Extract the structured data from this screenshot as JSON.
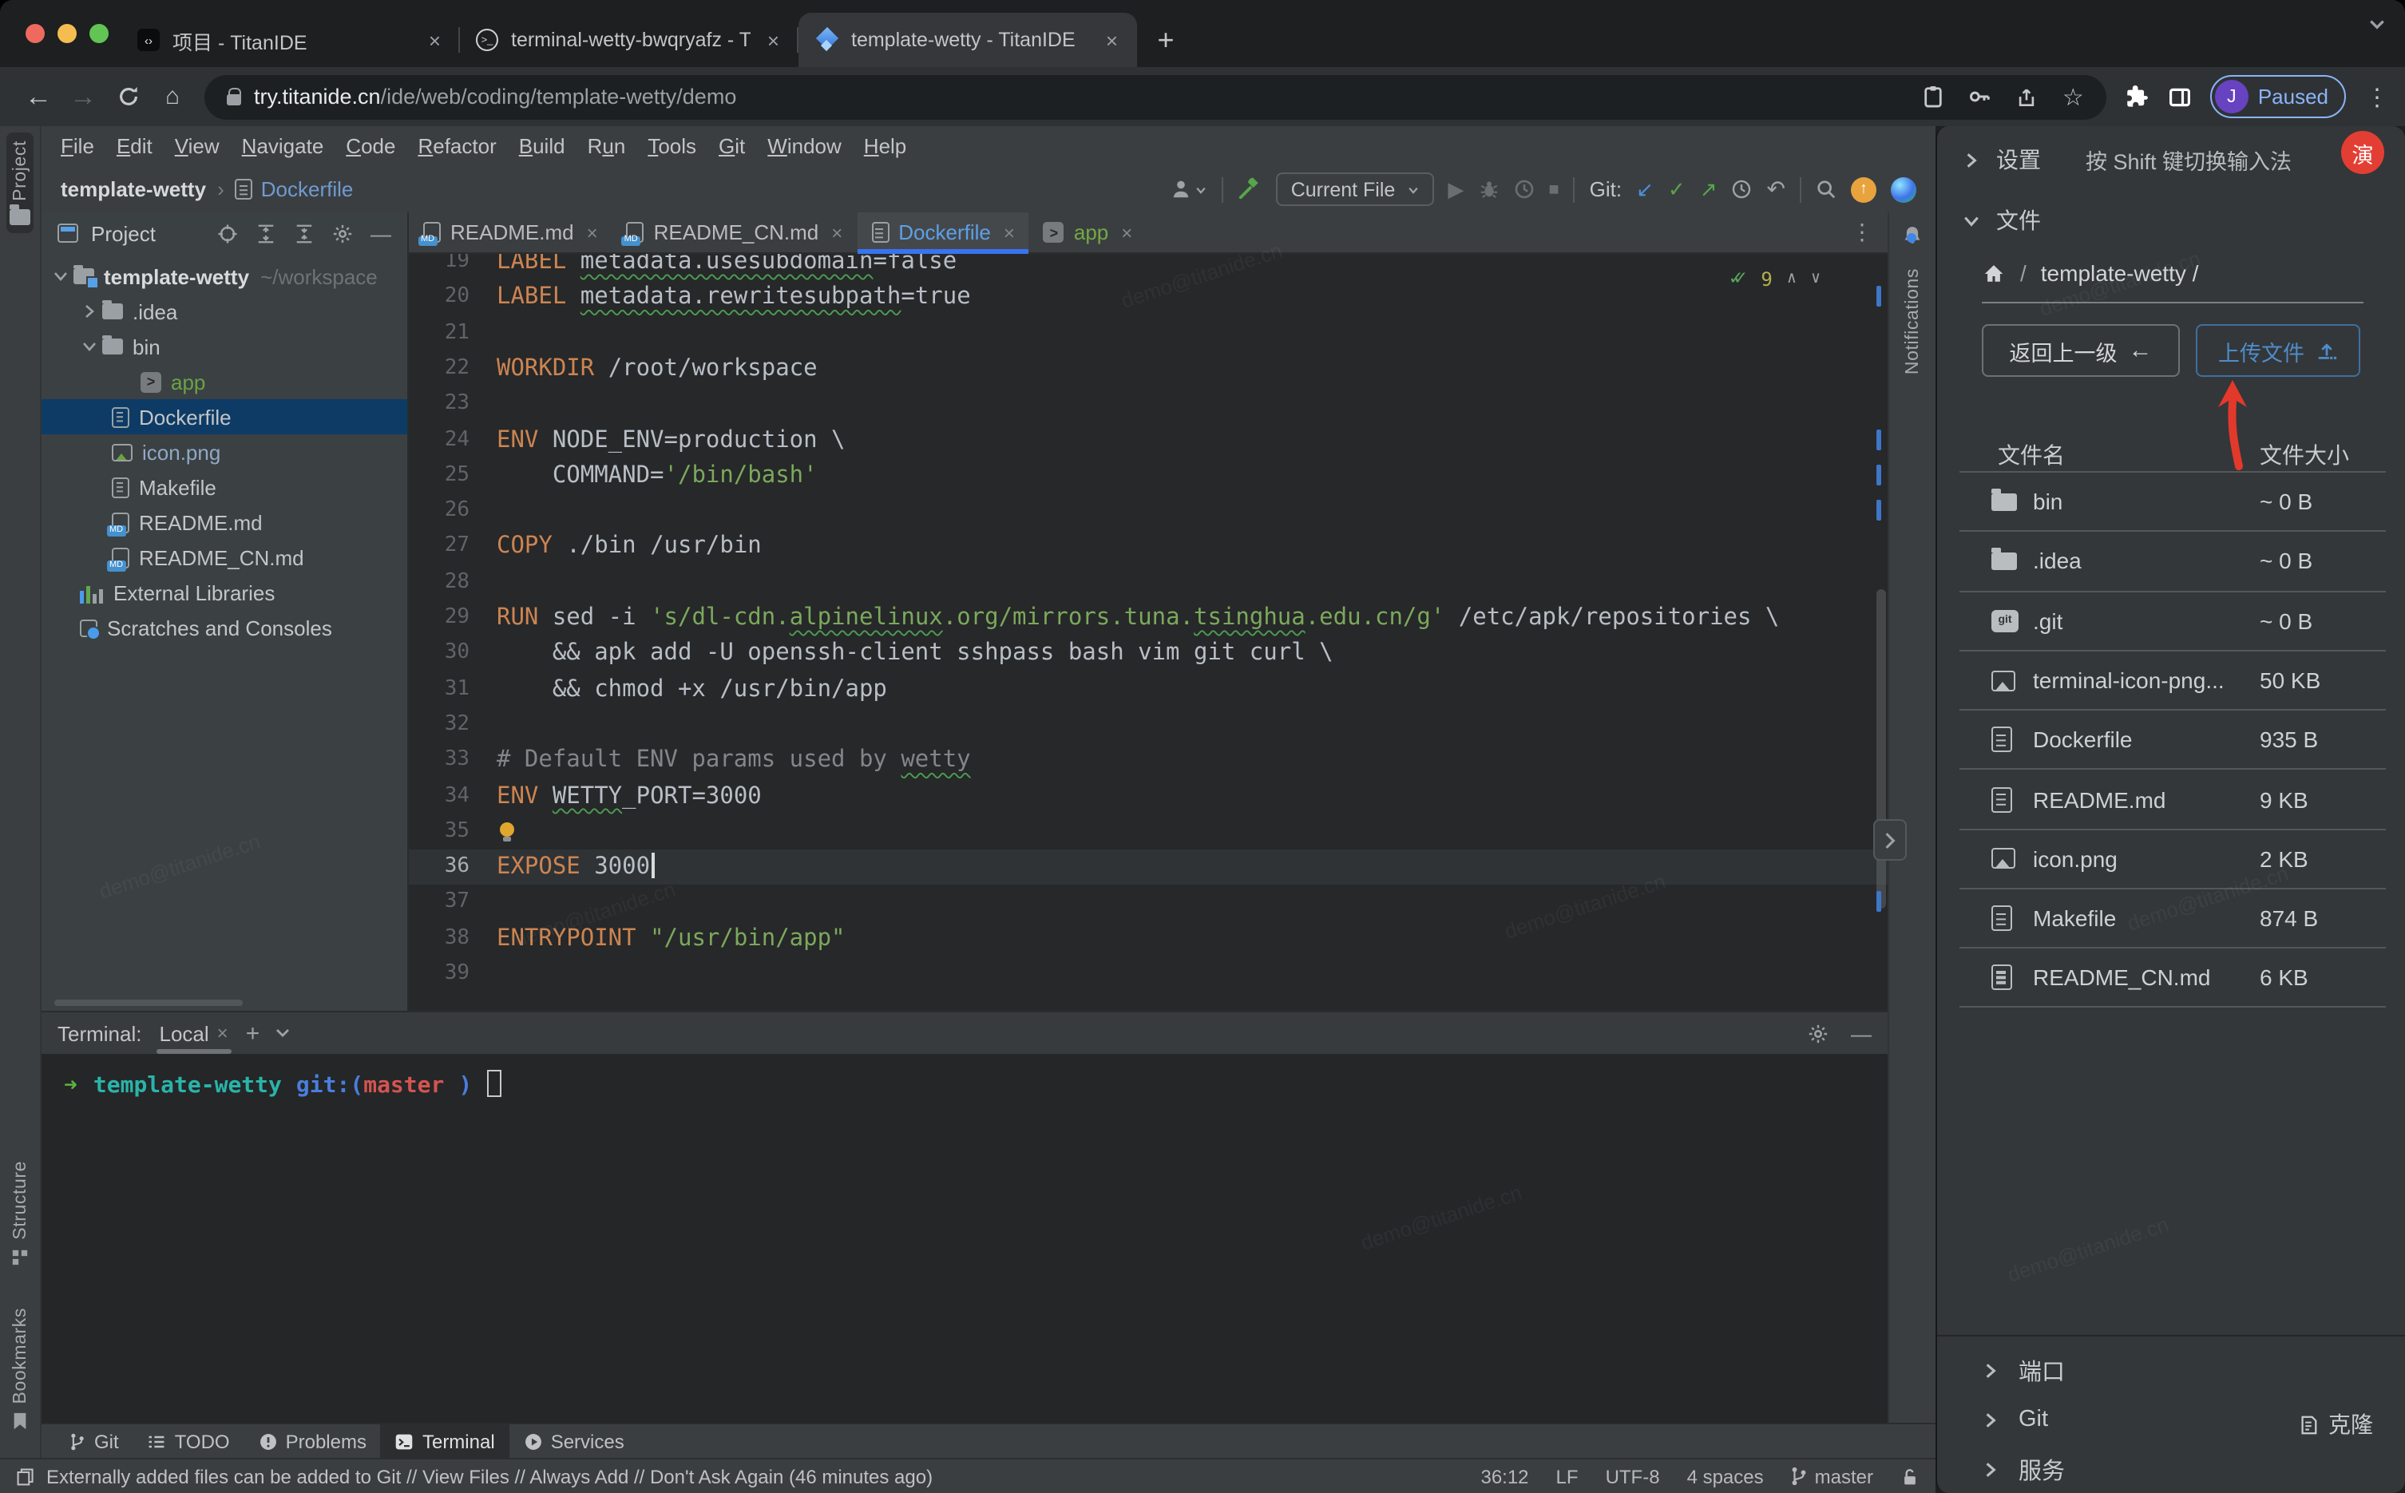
{
  "browser": {
    "tabs": [
      {
        "title": "项目 - TitanIDE",
        "icon": "codefav"
      },
      {
        "title": "terminal-wetty-bwqryafz - Tita",
        "icon": "termfav"
      },
      {
        "title": "template-wetty - TitanIDE",
        "icon": "titan",
        "active": true
      }
    ],
    "url_host": "try.titanide.cn",
    "url_path": "/ide/web/coding/template-wetty/demo",
    "profile_initial": "J",
    "profile_status": "Paused"
  },
  "menubar": {
    "items": [
      {
        "label": "File",
        "u": 0
      },
      {
        "label": "Edit",
        "u": 0
      },
      {
        "label": "View",
        "u": 0
      },
      {
        "label": "Navigate",
        "u": 0
      },
      {
        "label": "Code",
        "u": 0
      },
      {
        "label": "Refactor",
        "u": 0
      },
      {
        "label": "Build",
        "u": 0
      },
      {
        "label": "Run",
        "u": 1
      },
      {
        "label": "Tools",
        "u": 0
      },
      {
        "label": "Git",
        "u": 0
      },
      {
        "label": "Window",
        "u": 0
      },
      {
        "label": "Help",
        "u": 0
      }
    ]
  },
  "toolbar": {
    "breadcrumb_project": "template-wetty",
    "breadcrumb_file": "Dockerfile",
    "run_config": "Current File",
    "git_label": "Git:"
  },
  "side": {
    "project_label": "Project",
    "structure_label": "Structure",
    "bookmarks_label": "Bookmarks",
    "notifications_label": "Notifications"
  },
  "project": {
    "panel_title": "Project",
    "tree": [
      {
        "label": "template-wetty",
        "extra": "~/workspace",
        "icon": "folder-root",
        "chev": "down",
        "ind": 4,
        "bold": true
      },
      {
        "label": ".idea",
        "icon": "folder",
        "chev": "right",
        "ind": 22
      },
      {
        "label": "bin",
        "icon": "folder",
        "chev": "down",
        "ind": 22
      },
      {
        "label": "app",
        "icon": "app",
        "ind": 62,
        "cls": "green"
      },
      {
        "label": "Dockerfile",
        "icon": "doc",
        "ind": 44,
        "selected": true
      },
      {
        "label": "icon.png",
        "icon": "img",
        "ind": 44,
        "cls": "bluish"
      },
      {
        "label": "Makefile",
        "icon": "doc",
        "ind": 44
      },
      {
        "label": "README.md",
        "icon": "md",
        "ind": 44
      },
      {
        "label": "README_CN.md",
        "icon": "md",
        "ind": 44
      },
      {
        "label": "External Libraries",
        "icon": "ext",
        "ind": 24
      },
      {
        "label": "Scratches and Consoles",
        "icon": "scr",
        "ind": 24
      }
    ]
  },
  "editor": {
    "tabs": [
      {
        "label": "README.md",
        "icon": "md"
      },
      {
        "label": "README_CN.md",
        "icon": "md"
      },
      {
        "label": "Dockerfile",
        "icon": "doc",
        "active": true
      },
      {
        "label": "app",
        "icon": "app",
        "cls": "green"
      }
    ],
    "inspection_count": "9",
    "tick_lines": [
      20,
      24,
      25,
      26,
      37
    ],
    "lines": [
      {
        "n": 19,
        "seg": [
          [
            "kw",
            "LABEL "
          ],
          [
            "pl sq",
            "metadata.usesubdomain"
          ],
          [
            "pl",
            "=false"
          ]
        ]
      },
      {
        "n": 20,
        "seg": [
          [
            "kw",
            "LABEL "
          ],
          [
            "pl sq",
            "metadata.rewritesubpath"
          ],
          [
            "pl",
            "=true"
          ]
        ]
      },
      {
        "n": 21,
        "seg": []
      },
      {
        "n": 22,
        "seg": [
          [
            "kw",
            "WORKDIR "
          ],
          [
            "pl",
            "/root/workspace"
          ]
        ]
      },
      {
        "n": 23,
        "seg": []
      },
      {
        "n": 24,
        "seg": [
          [
            "kw",
            "ENV "
          ],
          [
            "pl",
            "NODE_ENV=production \\"
          ]
        ]
      },
      {
        "n": 25,
        "seg": [
          [
            "pl",
            "    COMMAND="
          ],
          [
            "str",
            "'/bin/bash'"
          ]
        ]
      },
      {
        "n": 26,
        "seg": []
      },
      {
        "n": 27,
        "seg": [
          [
            "kw",
            "COPY "
          ],
          [
            "pl",
            "./bin /usr/bin"
          ]
        ]
      },
      {
        "n": 28,
        "seg": []
      },
      {
        "n": 29,
        "seg": [
          [
            "kw",
            "RUN "
          ],
          [
            "pl",
            "sed -i "
          ],
          [
            "str",
            "'s/dl-cdn."
          ],
          [
            "str sq",
            "alpinelinux"
          ],
          [
            "str",
            ".org/mirrors.tuna."
          ],
          [
            "str sq",
            "tsinghua"
          ],
          [
            "str",
            ".edu.cn/g'"
          ],
          [
            "pl",
            " /etc/apk/repositories \\"
          ]
        ]
      },
      {
        "n": 30,
        "seg": [
          [
            "pl",
            "    && apk add -U openssh-client sshpass bash vim git curl \\"
          ]
        ]
      },
      {
        "n": 31,
        "seg": [
          [
            "pl",
            "    && chmod +x /usr/bin/app"
          ]
        ]
      },
      {
        "n": 32,
        "seg": []
      },
      {
        "n": 33,
        "seg": [
          [
            "cmt",
            "# Default ENV params used by "
          ],
          [
            "cmt sq",
            "wetty"
          ]
        ]
      },
      {
        "n": 34,
        "seg": [
          [
            "kw",
            "ENV "
          ],
          [
            "pl sq",
            "WETTY"
          ],
          [
            "pl",
            "_PORT=3000"
          ]
        ]
      },
      {
        "n": 35,
        "seg": [],
        "bulb": true
      },
      {
        "n": 36,
        "seg": [
          [
            "kw",
            "EXPOSE "
          ],
          [
            "pl",
            "3000"
          ]
        ],
        "current": true,
        "cursor": true
      },
      {
        "n": 37,
        "seg": []
      },
      {
        "n": 38,
        "seg": [
          [
            "kw",
            "ENTRYPOINT "
          ],
          [
            "str",
            "\"/usr/bin/app\""
          ]
        ]
      },
      {
        "n": 39,
        "seg": []
      }
    ]
  },
  "terminal": {
    "label": "Terminal:",
    "tab_label": "Local",
    "prompt": {
      "arrow": "➜",
      "dir": "template-wetty",
      "git_prefix": "git:(",
      "branch": "master",
      "git_suffix": ")"
    }
  },
  "toolwindows": {
    "items": [
      {
        "label": "Git",
        "icon": "branch"
      },
      {
        "label": "TODO",
        "icon": "todo"
      },
      {
        "label": "Problems",
        "icon": "problems"
      },
      {
        "label": "Terminal",
        "icon": "termtool",
        "active": true
      },
      {
        "label": "Services",
        "icon": "services"
      }
    ]
  },
  "statusbar": {
    "message": "Externally added files can be added to Git // View Files // Always Add // Don't Ask Again (46 minutes ago)",
    "caret": "36:12",
    "line_ending": "LF",
    "encoding": "UTF-8",
    "indent": "4 spaces",
    "branch": "master"
  },
  "rightpanel": {
    "settings": "设置",
    "ime_hint": "按 Shift 键切换输入法",
    "demo_badge": "演",
    "files_section": "文件",
    "path_project": "template-wetty /",
    "back_btn": "返回上一级",
    "upload_btn": "上传文件",
    "col_name": "文件名",
    "col_size": "文件大小",
    "rows": [
      {
        "name": "bin",
        "size": "~ 0 B",
        "icon": "folder"
      },
      {
        "name": ".idea",
        "size": "~ 0 B",
        "icon": "folder"
      },
      {
        "name": ".git",
        "size": "~ 0 B",
        "icon": "git"
      },
      {
        "name": "terminal-icon-png...",
        "size": "50 KB",
        "icon": "img"
      },
      {
        "name": "Dockerfile",
        "size": "935 B",
        "icon": "doc"
      },
      {
        "name": "README.md",
        "size": "9 KB",
        "icon": "doc"
      },
      {
        "name": "icon.png",
        "size": "2 KB",
        "icon": "img"
      },
      {
        "name": "Makefile",
        "size": "874 B",
        "icon": "doc"
      },
      {
        "name": "README_CN.md",
        "size": "6 KB",
        "icon": "doc"
      }
    ],
    "ports_section": "端口",
    "git_section": "Git",
    "services_section": "服务",
    "clone_btn": "克隆"
  },
  "watermark": "demo@titanide.cn",
  "colors": {
    "accent_blue": "#3674f0",
    "badge_red": "#e33e33",
    "upload_blue": "#4f8cc9",
    "selection_blue": "#0d3b66"
  }
}
